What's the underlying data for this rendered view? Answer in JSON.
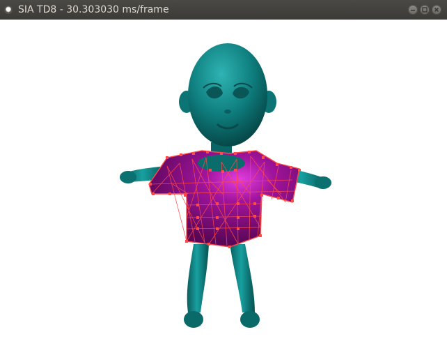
{
  "window": {
    "title": "SIA TD8 - 30.303030 ms/frame"
  },
  "titlebar_controls": [
    "minimize-button",
    "maximize-button",
    "close-button"
  ],
  "scene": {
    "background_color": "#ffffff",
    "character_color": "#0f7f7f",
    "cloth_color": "#8a0f86",
    "mesh_line_color": "#ff4a4a"
  }
}
